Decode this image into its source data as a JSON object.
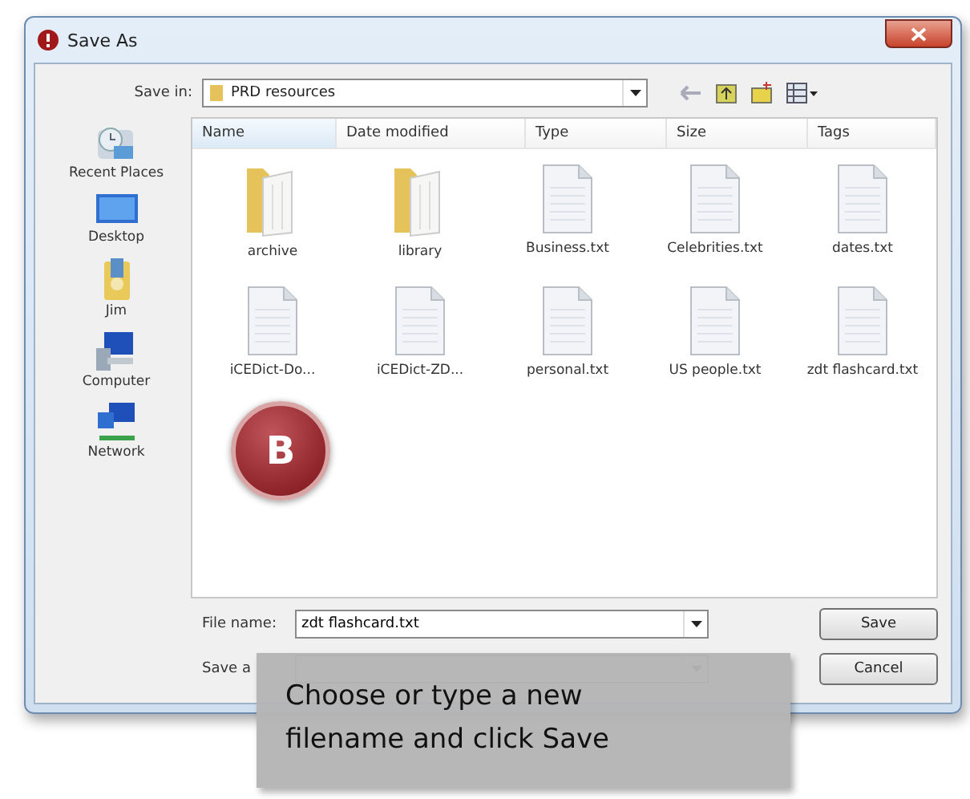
{
  "window": {
    "title": "Save As"
  },
  "save_in": {
    "label": "Save in:",
    "value": "PRD resources"
  },
  "sidebar": {
    "items": [
      {
        "label": "Recent Places",
        "kind": "recent"
      },
      {
        "label": "Desktop",
        "kind": "desktop"
      },
      {
        "label": "Jim",
        "kind": "user"
      },
      {
        "label": "Computer",
        "kind": "computer"
      },
      {
        "label": "Network",
        "kind": "network"
      }
    ]
  },
  "columns": [
    {
      "label": "Name",
      "sorted": true
    },
    {
      "label": "Date modified",
      "sorted": false
    },
    {
      "label": "Type",
      "sorted": false
    },
    {
      "label": "Size",
      "sorted": false
    },
    {
      "label": "Tags",
      "sorted": false
    }
  ],
  "files": [
    {
      "name": "archive",
      "kind": "folder"
    },
    {
      "name": "library",
      "kind": "folder"
    },
    {
      "name": "Business.txt",
      "kind": "text"
    },
    {
      "name": "Celebrities.txt",
      "kind": "text"
    },
    {
      "name": "dates.txt",
      "kind": "text"
    },
    {
      "name": "iCEDict-Do...",
      "kind": "text"
    },
    {
      "name": "iCEDict-ZD...",
      "kind": "text"
    },
    {
      "name": "personal.txt",
      "kind": "text"
    },
    {
      "name": "US people.txt",
      "kind": "text"
    },
    {
      "name": "zdt flashcard.txt",
      "kind": "text"
    }
  ],
  "badge": "B",
  "file_name": {
    "label": "File name:",
    "value": "zdt flashcard.txt"
  },
  "save_type": {
    "label": "Save a"
  },
  "buttons": [
    "Save",
    "Cancel"
  ],
  "callout": "Choose or type a new filename and click Save"
}
